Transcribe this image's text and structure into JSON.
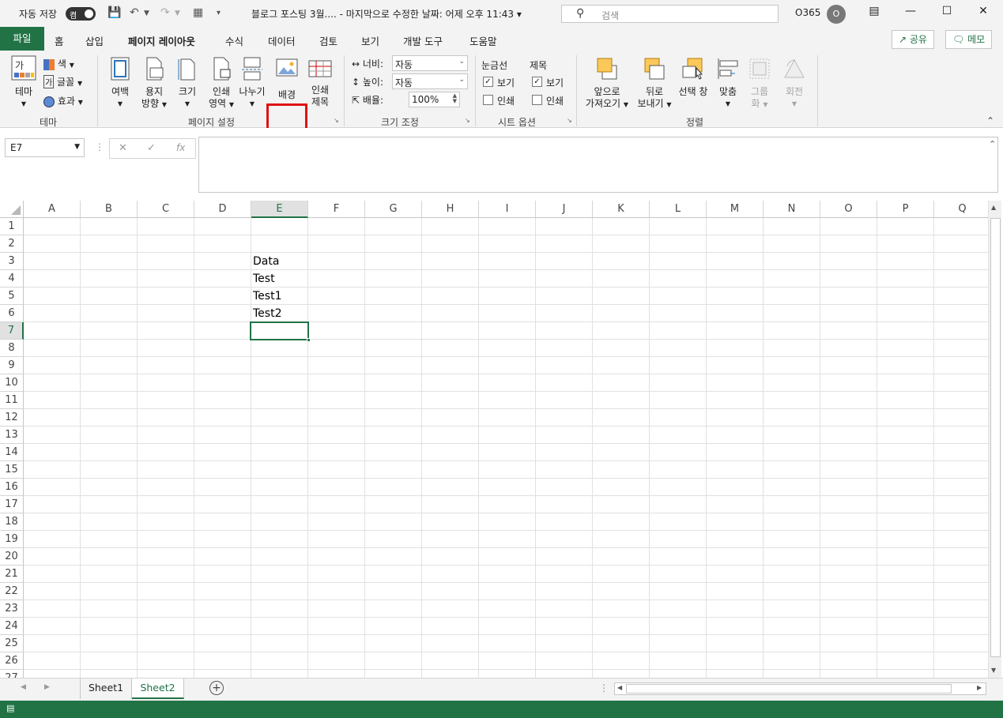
{
  "titlebar": {
    "autosave_label": "자동 저장",
    "autosave_state": "켬",
    "title": "블로그 포스팅 3월....  -  마지막으로 수정한 날짜: 어제 오후 11:43 ▾",
    "search_placeholder": "검색",
    "user": "O365",
    "avatar_initial": "O"
  },
  "tabs": [
    "파일",
    "홈",
    "삽입",
    "페이지 레이아웃",
    "수식",
    "데이터",
    "검토",
    "보기",
    "개발 도구",
    "도움말"
  ],
  "active_tab": "페이지 레이아웃",
  "header_buttons": {
    "share": "공유",
    "comments": "메모"
  },
  "ribbon": {
    "theme": {
      "themes": "테마",
      "colors": "색",
      "fonts": "글꼴",
      "effects": "효과",
      "group": "테마"
    },
    "page_setup": {
      "margins": "여백",
      "orientation_1": "용지",
      "orientation_2": "방향",
      "size": "크기",
      "print_area_1": "인쇄",
      "print_area_2": "영역",
      "breaks": "나누기",
      "background": "배경",
      "print_titles_1": "인쇄",
      "print_titles_2": "제목",
      "group": "페이지 설정"
    },
    "scale": {
      "width_label": "너비:",
      "width_value": "자동",
      "height_label": "높이:",
      "height_value": "자동",
      "scale_label": "배율:",
      "scale_value": "100%",
      "group": "크기 조정"
    },
    "sheet_options": {
      "gridlines": "눈금선",
      "headings": "제목",
      "view": "보기",
      "print": "인쇄",
      "group": "시트 옵션"
    },
    "arrange": {
      "bring_forward_1": "앞으로",
      "bring_forward_2": "가져오기",
      "send_backward_1": "뒤로",
      "send_backward_2": "보내기",
      "selection_pane": "선택 창",
      "align": "맞춤",
      "group_1": "그룹",
      "group_2": "화",
      "rotate": "회전",
      "group": "정렬"
    }
  },
  "formula_bar": {
    "name_box": "E7",
    "fx": "fx",
    "formula": ""
  },
  "columns": [
    "A",
    "B",
    "C",
    "D",
    "E",
    "F",
    "G",
    "H",
    "I",
    "J",
    "K",
    "L",
    "M",
    "N",
    "O",
    "P",
    "Q"
  ],
  "rows": [
    "1",
    "2",
    "3",
    "4",
    "5",
    "6",
    "7",
    "8",
    "9",
    "10",
    "11",
    "12",
    "13",
    "14",
    "15",
    "16",
    "17",
    "18",
    "19",
    "20",
    "21",
    "22",
    "23",
    "24",
    "25",
    "26",
    "27"
  ],
  "active_cell": "E7",
  "cells": {
    "E3": "Data",
    "E4": "Test",
    "E5": "Test1",
    "E6": "Test2"
  },
  "sheets": [
    "Sheet1",
    "Sheet2"
  ],
  "active_sheet": "Sheet2",
  "colors": {
    "accent": "#217346",
    "highlight": "#e01010"
  }
}
